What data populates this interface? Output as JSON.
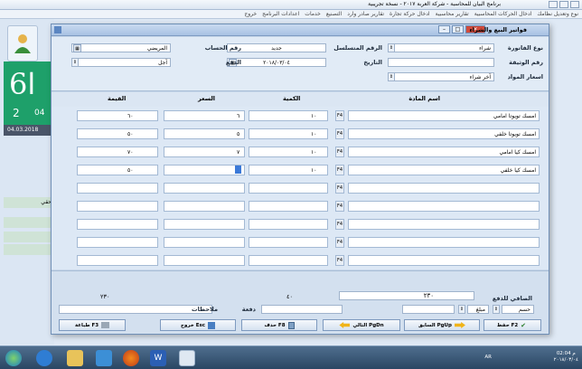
{
  "app": {
    "title": "برنامج البيان للمحاسبة - شركة العربة ٢٠١٧ - نسخة تجريبية",
    "menu": [
      "نوع وتعديل نظامك",
      "ادخال الحركات المحاسبية",
      "تقارير محاسبية",
      "ادخال حركة تجارة",
      "تقارير صادر وارد",
      "التصنيع",
      "خدمات",
      "اعدادات البرنامج",
      "خروج"
    ],
    "logo_letter": "6ا",
    "logo_num": "2",
    "tile_num": "04",
    "date_strip": "04.03.2018",
    "side_items": [
      "حقي",
      "",
      "",
      ""
    ]
  },
  "dialog": {
    "title": "فواتير البيع والشراء",
    "header": {
      "invoice_type_label": "نوع الفاتورة",
      "invoice_type_value": "شراء",
      "doc_number_label": "رقم الوثيقة",
      "price_label": "اسعار المواد",
      "price_value": "آخر شراء",
      "serial_label": "الرقم المتسلسل",
      "serial_value": "جديد",
      "date_label": "التاريخ",
      "date_value": "٢٠١٨/٠٣/٠٤",
      "account_label": "رقم الحساب",
      "account_value": "المريضي",
      "payment_label": "الدفع",
      "payment_value": "آجل"
    },
    "columns": {
      "item": "اسم المادة",
      "qty": "الكمية",
      "price": "السعر",
      "value": "القيمة"
    },
    "rows": [
      {
        "name": "امسك تويوتا امامي",
        "qty": "١٠",
        "price": "٦",
        "value": "٦٠"
      },
      {
        "name": "امسك تويوتا خلفي",
        "qty": "١٠",
        "price": "٥",
        "value": "٥٠"
      },
      {
        "name": "امسك كيا امامي",
        "qty": "١٠",
        "price": "٧",
        "value": "٧٠"
      },
      {
        "name": "امسك كيا خلفي",
        "qty": "١٠",
        "price": "٥",
        "value": "٥٠"
      },
      {
        "name": "",
        "qty": "",
        "price": "",
        "value": ""
      },
      {
        "name": "",
        "qty": "",
        "price": "",
        "value": ""
      },
      {
        "name": "",
        "qty": "",
        "price": "",
        "value": ""
      },
      {
        "name": "",
        "qty": "",
        "price": "",
        "value": ""
      },
      {
        "name": "",
        "qty": "",
        "price": "",
        "value": ""
      }
    ],
    "footer": {
      "total_value": "٢٣٠",
      "total_qty": "٤٠",
      "net_label": "الصافي للدفع",
      "net_value": "٢٣٠",
      "discount_label": "حسم",
      "amount_label": "مبلغ",
      "notes_label": "ملاحظات",
      "payment_label": "دفعة"
    },
    "buttons": {
      "save": "حفظ F2",
      "prev": "السابق PgUp",
      "next": "التالي PgDn",
      "delete": "حذف F8",
      "exit": "خروج Esc",
      "print": "طباعة F3"
    },
    "f4": "F4"
  },
  "taskbar": {
    "time": "02:04 م",
    "date": "٢٠١٨/٠٣/٠٤",
    "lang": "AR"
  }
}
